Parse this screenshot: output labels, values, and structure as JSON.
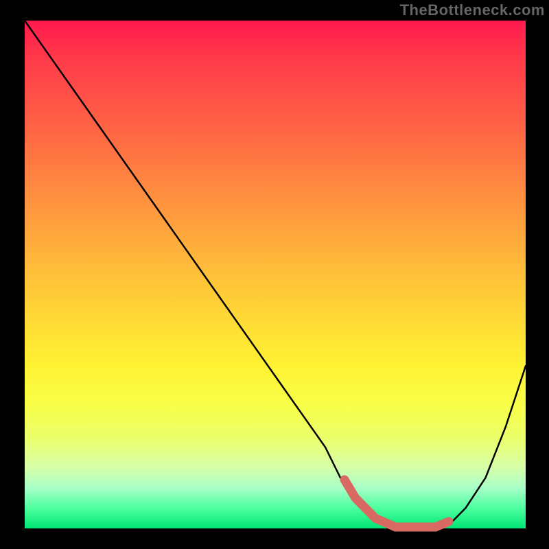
{
  "watermark": "TheBottleneck.com",
  "chart_data": {
    "type": "line",
    "title": "",
    "xlabel": "",
    "ylabel": "",
    "xlim": [
      0,
      100
    ],
    "ylim": [
      0,
      100
    ],
    "series": [
      {
        "name": "bottleneck-curve",
        "x": [
          0,
          5,
          10,
          15,
          20,
          25,
          30,
          35,
          40,
          45,
          50,
          55,
          60,
          63,
          66,
          70,
          74,
          78,
          82,
          85,
          88,
          92,
          96,
          100
        ],
        "values": [
          100,
          93,
          86,
          79,
          72,
          65,
          58,
          51,
          44,
          37,
          30,
          23,
          16,
          10,
          6,
          2,
          0,
          0,
          0,
          1,
          4,
          10,
          20,
          32
        ]
      }
    ],
    "highlight": {
      "name": "optimal-range",
      "x": [
        63,
        66,
        70,
        74,
        78,
        82,
        85
      ],
      "values": [
        10,
        6,
        2,
        0,
        0,
        0,
        1
      ],
      "color": "#d96a63"
    },
    "gradient_stops": [
      {
        "pos": 0,
        "color": "#ff1a4d"
      },
      {
        "pos": 50,
        "color": "#ffd836"
      },
      {
        "pos": 80,
        "color": "#f8ff4a"
      },
      {
        "pos": 100,
        "color": "#00e676"
      }
    ]
  }
}
